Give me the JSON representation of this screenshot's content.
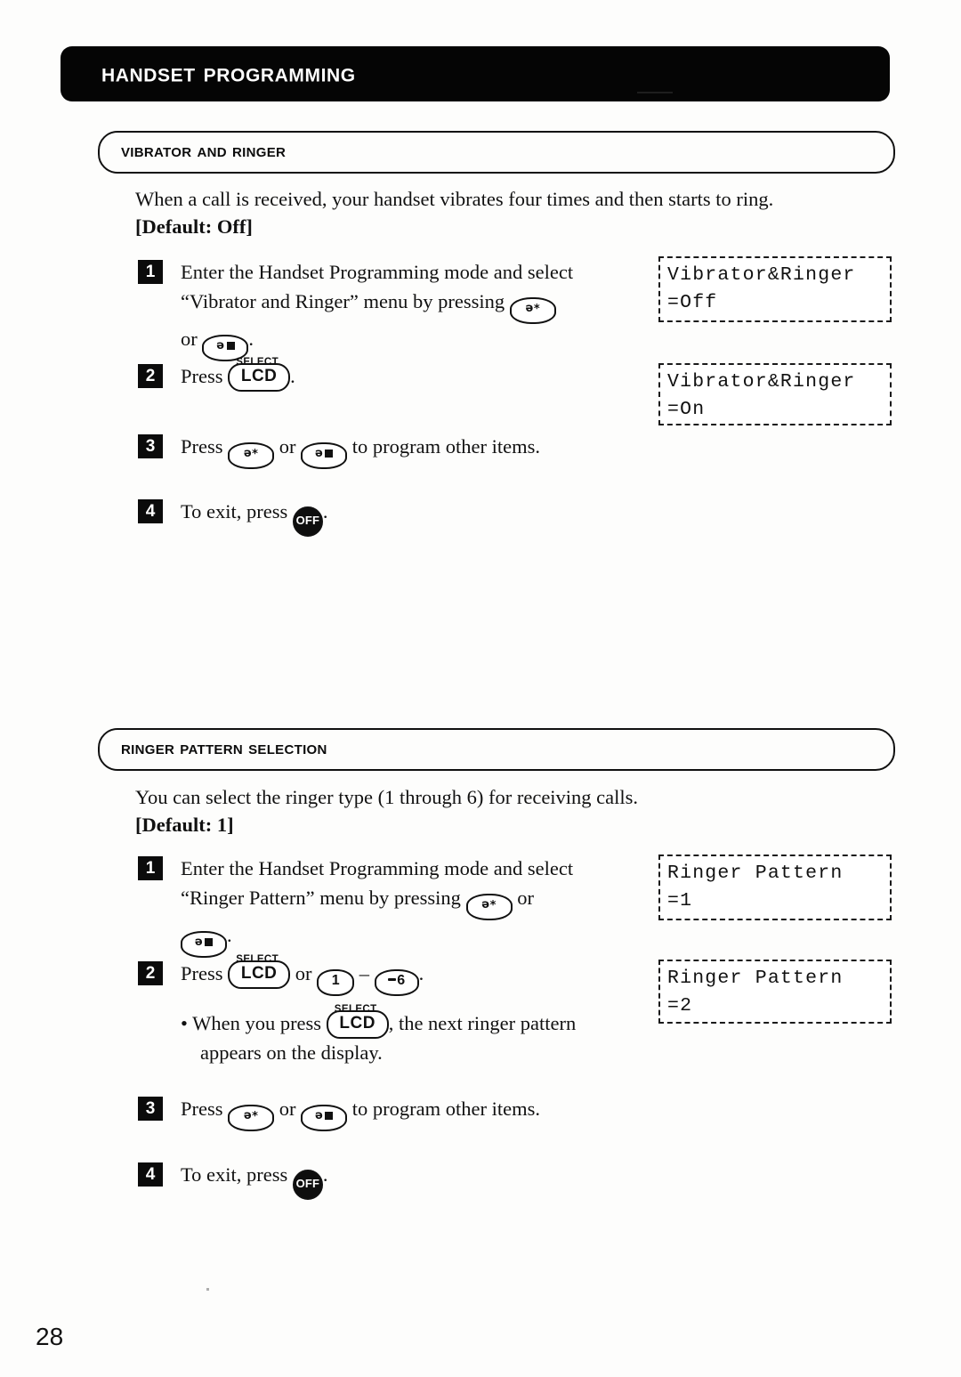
{
  "document": {
    "chapter_title": "Handset Programming",
    "page_number": "28"
  },
  "sections": [
    {
      "heading": "Vibrator and Ringer",
      "intro_line1": "When a call is received, your handset vibrates four times and then starts to ring.",
      "intro_line2": "[Default: Off]",
      "steps": [
        {
          "number": "1",
          "line1_a": "Enter the Handset Programming mode and select",
          "line2_a": "“Vibrator and Ringer” menu by pressing",
          "line3_a": "or",
          "line3_b": "."
        },
        {
          "number": "2",
          "line1_a": "Press",
          "line1_b": "."
        },
        {
          "number": "3",
          "line1_a": "Press",
          "line1_b": "or",
          "line1_c": "to program other items."
        },
        {
          "number": "4",
          "line1_a": "To exit, press",
          "line1_b": "."
        }
      ],
      "displays": [
        {
          "line1": "Vibrator&Ringer",
          "line2": "=Off"
        },
        {
          "line1": "Vibrator&Ringer",
          "line2": "=On"
        }
      ]
    },
    {
      "heading": "Ringer Pattern Selection",
      "intro_line1": "You can select the ringer type (1 through 6) for receiving calls.",
      "intro_line2": "[Default: 1]",
      "steps": [
        {
          "number": "1",
          "line1_a": "Enter the Handset Programming mode and select",
          "line2_a": "“Ringer Pattern” menu by pressing",
          "line2_b": "or",
          "line3_b": "."
        },
        {
          "number": "2",
          "line1_a": "Press",
          "line1_b": "or",
          "line1_c": "–",
          "line1_d": ".",
          "bullet_a": "• When you press",
          "bullet_b": ", the next ringer pattern",
          "bullet_line2": "appears on the display."
        },
        {
          "number": "3",
          "line1_a": "Press",
          "line1_b": "or",
          "line1_c": "to program other items."
        },
        {
          "number": "4",
          "line1_a": "To exit, press",
          "line1_b": "."
        }
      ],
      "displays": [
        {
          "line1": "Ringer Pattern",
          "line2": "=1"
        },
        {
          "line1": "Ringer Pattern",
          "line2": "=2"
        }
      ]
    }
  ],
  "keys": {
    "scroll_up_label": "ə*",
    "scroll_down_label": "ǝ■",
    "lcd_label": "LCD",
    "select_label": "SELECT",
    "off_label": "OFF",
    "digit_one": "1",
    "digit_six": "6"
  }
}
